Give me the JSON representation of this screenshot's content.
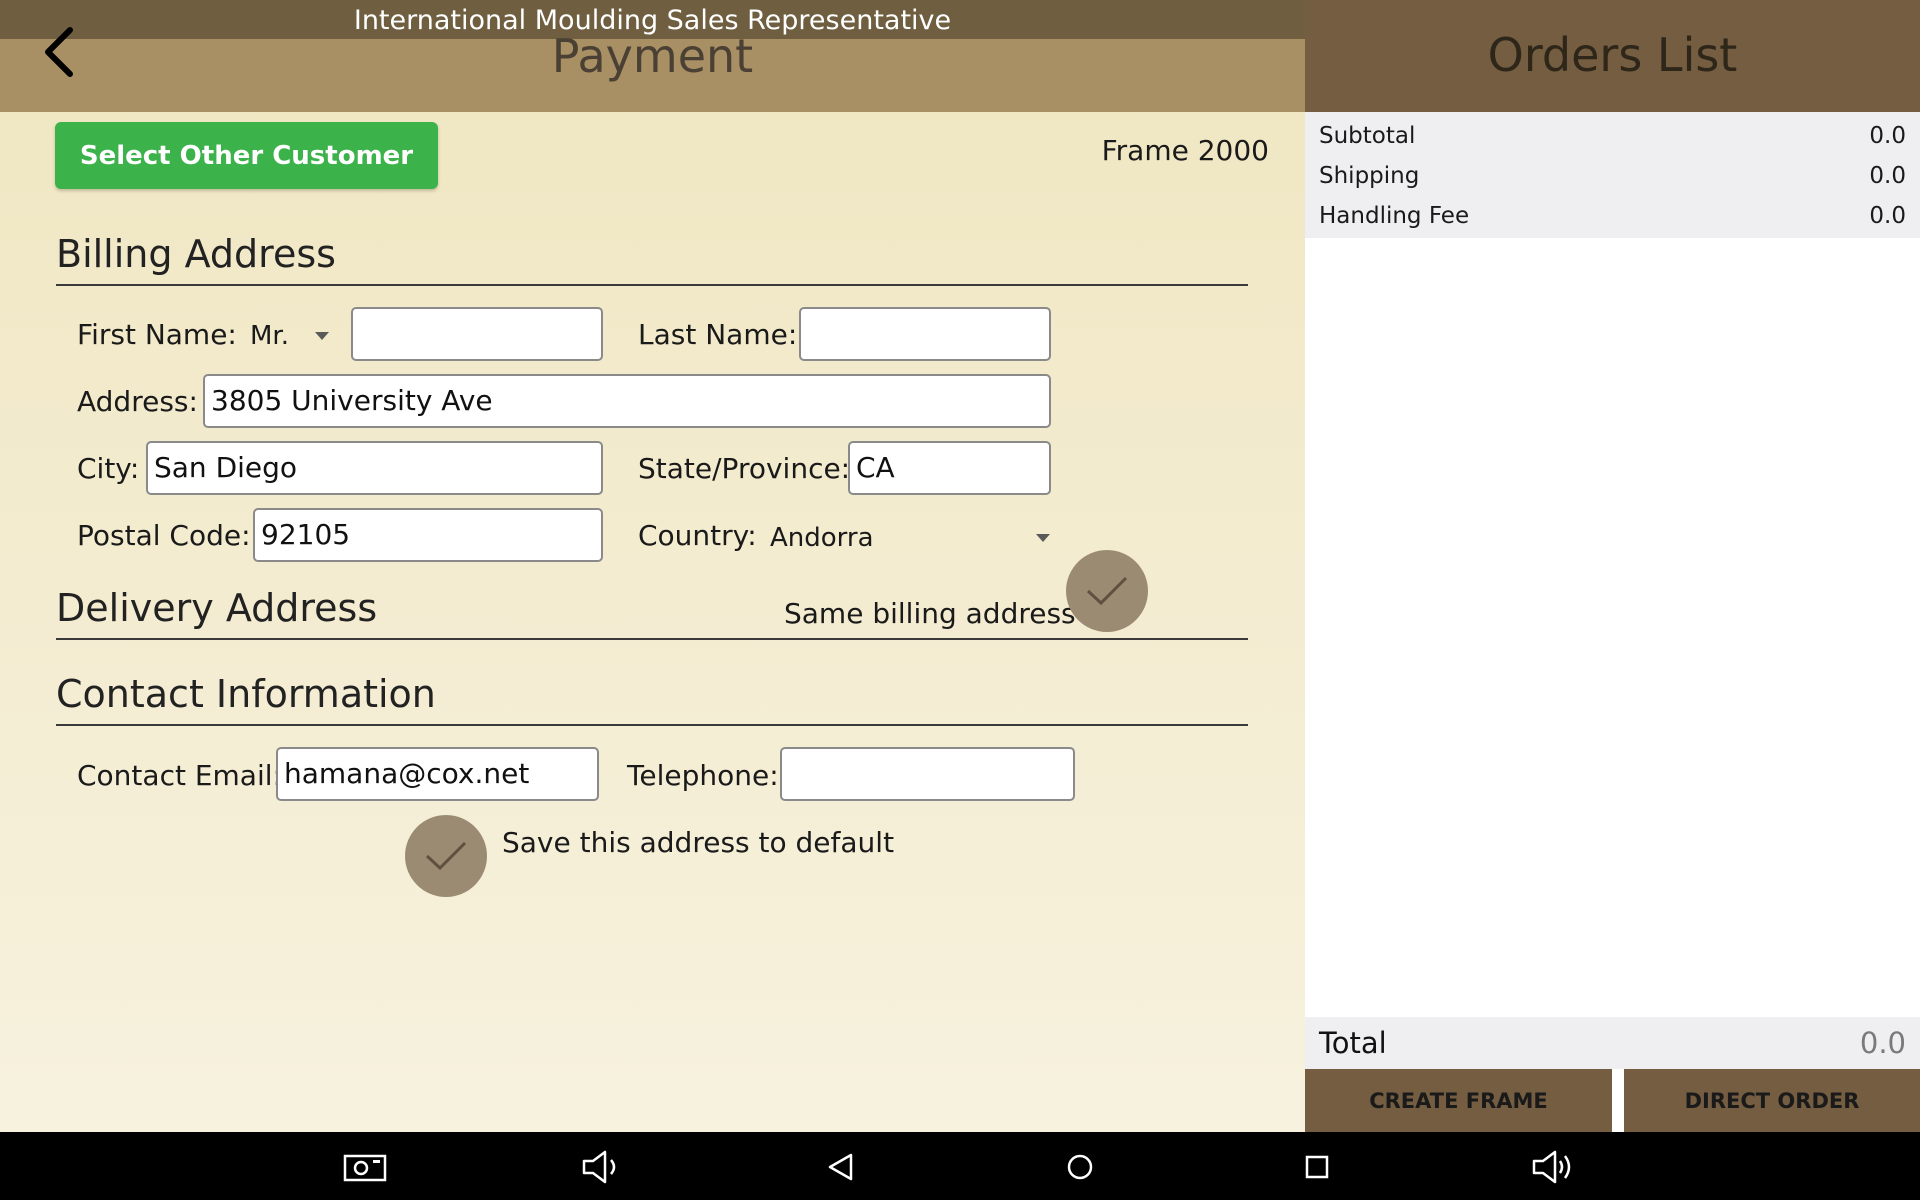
{
  "status_bar": {
    "app_title": "International Moulding Sales Representative"
  },
  "header": {
    "title": "Payment",
    "back_icon": "chevron-left-icon"
  },
  "select_customer_button": "Select Other Customer",
  "frame_label": "Frame 2000",
  "billing": {
    "title": "Billing Address",
    "first_name_label": "First Name:",
    "salutation": "Mr.",
    "first_name_value": "",
    "last_name_label": "Last Name:",
    "last_name_value": "",
    "address_label": "Address:",
    "address_value": "3805 University Ave",
    "city_label": "City:",
    "city_value": "San Diego",
    "state_label": "State/Province:",
    "state_value": "CA",
    "postal_label": "Postal Code:",
    "postal_value": "92105",
    "country_label": "Country:",
    "country_value": "Andorra"
  },
  "delivery": {
    "title": "Delivery Address",
    "same_billing_label": "Same billing address",
    "same_billing_checked": true
  },
  "contact": {
    "title": "Contact Information",
    "email_label": "Contact Email:",
    "email_value": "hamana@cox.net",
    "phone_label": "Telephone:",
    "phone_value": "",
    "save_default_label": "Save this address to default",
    "save_default_checked": true
  },
  "orders": {
    "title": "Orders List",
    "summary": [
      {
        "label": "Subtotal",
        "value": "0.0"
      },
      {
        "label": "Shipping",
        "value": "0.0"
      },
      {
        "label": "Handling Fee",
        "value": "0.0"
      }
    ],
    "total_label": "Total",
    "total_value": "0.0",
    "create_frame_button": "CREATE FRAME",
    "direct_order_button": "DIRECT ORDER"
  },
  "colors": {
    "status_bar": "#6f5f40",
    "header": "#a98f64",
    "orders_header": "#745d40",
    "accent_green": "#3bb34a",
    "check_circle": "#9b8b73"
  },
  "nav_bar": {
    "icons": [
      "screenshot-icon",
      "volume-down-icon",
      "back-triangle-icon",
      "home-circle-icon",
      "recents-square-icon",
      "volume-up-icon"
    ]
  }
}
